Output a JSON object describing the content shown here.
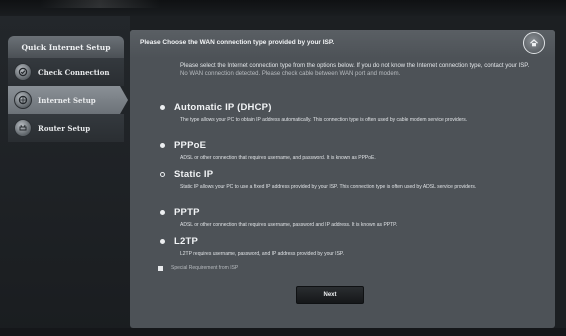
{
  "sidebar": {
    "header": "Quick Internet Setup",
    "items": [
      {
        "label": "Check Connection",
        "icon": "globe-check-icon",
        "active": false
      },
      {
        "label": "Internet Setup",
        "icon": "globe-settings-icon",
        "active": true
      },
      {
        "label": "Router Setup",
        "icon": "router-gear-icon",
        "active": false
      }
    ]
  },
  "main": {
    "title": "Please Choose the WAN connection type provided by your ISP.",
    "home_icon": "home-icon",
    "intro": "Please select the Internet connection type from the options below. If you do not know the Internet connection type, contact your ISP.",
    "warning": "No WAN connection detected. Please check cable between WAN port and modem.",
    "options": [
      {
        "label": "Automatic IP (DHCP)",
        "selected": true,
        "description": "The type allows your PC to obtain IP address automatically. This connection type is often used by cable modem service providers."
      },
      {
        "label": "PPPoE",
        "selected": true,
        "description": "ADSL or other connection that requires username, and password. It is known as PPPoE."
      },
      {
        "label": "Static IP",
        "selected": false,
        "description": "Static IP allows your PC to use a fixed IP address provided by your ISP. This connection type is often used by ADSL service providers."
      },
      {
        "label": "PPTP",
        "selected": true,
        "description": "ADSL or other connection that requires username, password and IP address. It is known as PPTP."
      },
      {
        "label": "L2TP",
        "selected": true,
        "description": "L2TP requires username, password, and IP address provided by your ISP."
      }
    ],
    "special_requirement": "Special Requirement from ISP",
    "next_label": "Next"
  }
}
